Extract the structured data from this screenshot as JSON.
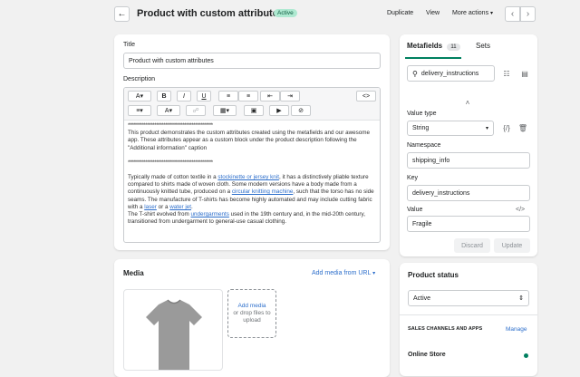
{
  "header": {
    "title": "Product with custom attributes",
    "status": "Active",
    "actions": [
      "Duplicate",
      "View",
      "More actions"
    ]
  },
  "product": {
    "title_label": "Title",
    "title_value": "Product with custom attributes",
    "description_label": "Description",
    "toolbar": {
      "paragraph_glyph": "A",
      "bold": "B",
      "italic": "I",
      "underline": "U",
      "color_glyph": "A",
      "html_toggle": "<>"
    },
    "separator": "************************************************",
    "intro": "This product demonstrates the custom attributes created using the metafields and our awesome app. These attributes appear as a custom block under the product description following the \"Additional information\" caption",
    "body_parts": [
      "Typically made of cotton textile in a ",
      "stockinette or jersey knit",
      ", it has a distinctively pliable texture compared to shirts made of woven cloth. Some modern versions have a body made from a continuously knitted tube, produced on a ",
      "circular knitting machine",
      ", such that the torso has no side seams. The manufacture of T-shirts has become highly automated and may include cutting fabric with a ",
      "laser",
      " or a ",
      "water jet",
      ".",
      "The T-shirt evolved from ",
      "undergarments",
      " used in the 19th century and, in the mid-20th century, transitioned from undergarment to general-use casual clothing."
    ]
  },
  "media": {
    "title": "Media",
    "add_from_url": "Add media from URL",
    "add_media": "Add media",
    "drop_hint": "or drop files to upload"
  },
  "metafields": {
    "tab_metafields": "Metafields",
    "tab_count": "11",
    "tab_sets": "Sets",
    "search_value": "delivery_instructions",
    "value_type_label": "Value type",
    "value_type": "String",
    "namespace_label": "Namespace",
    "namespace_value": "shipping_info",
    "key_label": "Key",
    "key_value": "delivery_instructions",
    "value_label": "Value",
    "value_code": "</>",
    "value_value": "Fragile",
    "discard": "Discard",
    "update": "Update",
    "braces": "{/}"
  },
  "product_status": {
    "title": "Product status",
    "selected": "Active",
    "channels_label": "SALES CHANNELS AND APPS",
    "manage": "Manage",
    "online_store": "Online Store"
  },
  "colors": {
    "accent": "#2c6ecb",
    "badge_bg": "#aee9d1",
    "online_dot": "#007f5f"
  }
}
